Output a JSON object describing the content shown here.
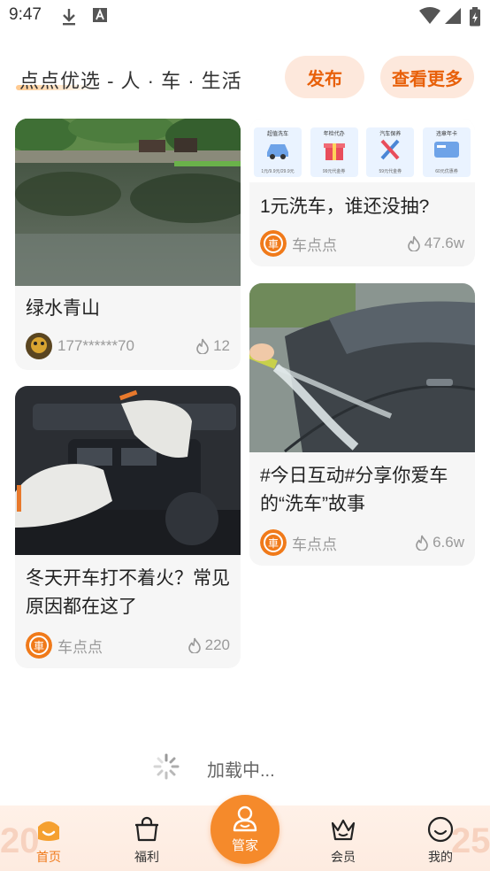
{
  "status_bar": {
    "time": "9:47",
    "icons": [
      "download-icon",
      "font-a-icon",
      "wifi-icon",
      "signal-icon",
      "battery-icon"
    ]
  },
  "header": {
    "title": "点点优选 - 人 · 车 · 生活",
    "publish_label": "发布",
    "more_label": "查看更多",
    "accent_color": "#e8600a"
  },
  "feed": {
    "left": [
      {
        "title": "绿水青山",
        "author": "177******70",
        "likes": "12",
        "image": "lake-landscape",
        "avatar": "user-avatar"
      },
      {
        "title": "冬天开车打不着火？常见原因都在这了",
        "author": "车点点",
        "likes": "220",
        "image": "engine-bay",
        "avatar": "chediandian-logo"
      }
    ],
    "right": [
      {
        "title": "1元洗车，谁还没抽?",
        "author": "车点点",
        "likes": "47.6w",
        "image": "coupon-banner",
        "avatar": "chediandian-logo",
        "coupons": [
          {
            "name": "超值洗车",
            "sub": "1元/9.9元/29.9元"
          },
          {
            "name": "年检代办",
            "sub": "99元代金券"
          },
          {
            "name": "汽车保养",
            "sub": "59元代金券"
          },
          {
            "name": "违章年卡",
            "sub": "60元优惠券"
          }
        ]
      },
      {
        "title": "#今日互动#分享你爱车的“洗车”故事",
        "author": "车点点",
        "likes": "6.6w",
        "image": "car-washing",
        "avatar": "chediandian-logo"
      }
    ]
  },
  "loading_text": "加载中...",
  "bottom_nav": {
    "items": [
      {
        "label": "首页",
        "icon": "home-icon",
        "active": true
      },
      {
        "label": "福利",
        "icon": "gift-bag-icon",
        "active": false
      },
      {
        "label": "管家",
        "icon": "butler-icon",
        "active": false,
        "center": true
      },
      {
        "label": "会员",
        "icon": "crown-icon",
        "active": false
      },
      {
        "label": "我的",
        "icon": "smile-icon",
        "active": false
      }
    ],
    "active_color": "#f07a1a",
    "center_color": "#f58a2b"
  }
}
